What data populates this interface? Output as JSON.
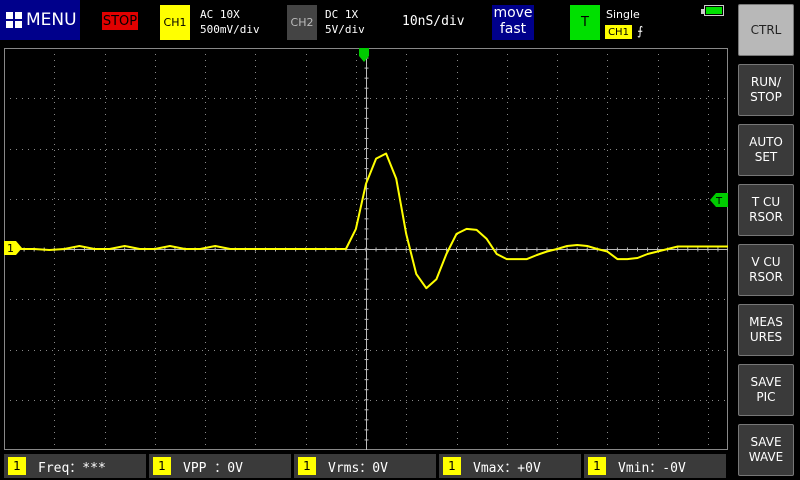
{
  "top_bar": {
    "menu_label": "MENU",
    "run_state": "STOP",
    "ch1": {
      "badge": "CH1",
      "coupling": "AC 10X",
      "scale": "500mV/div"
    },
    "ch2": {
      "badge": "CH2",
      "coupling": "DC 1X",
      "scale": "5V/div"
    },
    "timebase": "10nS/div",
    "move": {
      "line1": "move",
      "line2": "fast"
    },
    "trigger": {
      "badge": "T",
      "mode": "Single",
      "source": "CH1",
      "edge": "⨍"
    },
    "battery_level": 1.0
  },
  "screen": {
    "ch1_marker": "1",
    "trig_marker": "T",
    "trace_color": "#ffff00",
    "grid_color": "#888888",
    "chart_data": {
      "type": "line",
      "series": [
        {
          "x": [
            0,
            0.3,
            0.6,
            0.9,
            1.2,
            1.5,
            1.8,
            2.1,
            2.4,
            2.7,
            3.0,
            3.3,
            3.6,
            3.9,
            4.2,
            4.5,
            4.8,
            5.0,
            5.2,
            5.4,
            5.6,
            5.8,
            6.0,
            6.2,
            6.4,
            6.6,
            6.8,
            7.0,
            7.2,
            7.4,
            7.6,
            7.8,
            8.0,
            8.2,
            8.4,
            8.6,
            8.8,
            9.0,
            9.2,
            9.4,
            9.6,
            9.8,
            10.0,
            10.2,
            10.4,
            10.6,
            10.8,
            11.0,
            11.2,
            11.4,
            11.6,
            11.8,
            12.0,
            12.2,
            12.4,
            12.6,
            12.8,
            13.0,
            13.2,
            13.4,
            13.6,
            13.8,
            14.0,
            14.2,
            14.4
          ],
          "y": [
            0,
            0,
            0,
            -0.02,
            0,
            0.06,
            0,
            0,
            0.06,
            0,
            0,
            0.06,
            0,
            0,
            0.06,
            0,
            0,
            0,
            0,
            0,
            0,
            0,
            0,
            0,
            0,
            0,
            0,
            0.4,
            1.3,
            1.8,
            1.9,
            1.4,
            0.3,
            -0.5,
            -0.78,
            -0.6,
            -0.1,
            0.3,
            0.4,
            0.38,
            0.2,
            -0.1,
            -0.2,
            -0.2,
            -0.2,
            -0.12,
            -0.05,
            0,
            0.06,
            0.08,
            0.06,
            0,
            -0.05,
            -0.2,
            -0.2,
            -0.18,
            -0.1,
            -0.05,
            0,
            0.05,
            0.05,
            0.05,
            0.05,
            0.05,
            0.05
          ]
        }
      ],
      "xlim": [
        0,
        14.4
      ],
      "ylim": [
        -4,
        4
      ],
      "grid": true
    }
  },
  "side_buttons": [
    {
      "label": "CTRL",
      "active": true
    },
    {
      "label": "RUN/\nSTOP"
    },
    {
      "label": "AUTO\nSET"
    },
    {
      "label": "T CU\nRSOR"
    },
    {
      "label": "V CU\nRSOR"
    },
    {
      "label": "MEAS\nURES"
    },
    {
      "label": "SAVE\nPIC"
    },
    {
      "label": "SAVE\nWAVE"
    }
  ],
  "measures": [
    {
      "ch": "1",
      "text": "Freq：***"
    },
    {
      "ch": "1",
      "text": "VPP ：0V"
    },
    {
      "ch": "1",
      "text": "Vrms：0V"
    },
    {
      "ch": "1",
      "text": "Vmax：+0V"
    },
    {
      "ch": "1",
      "text": "Vmin：-0V"
    }
  ]
}
